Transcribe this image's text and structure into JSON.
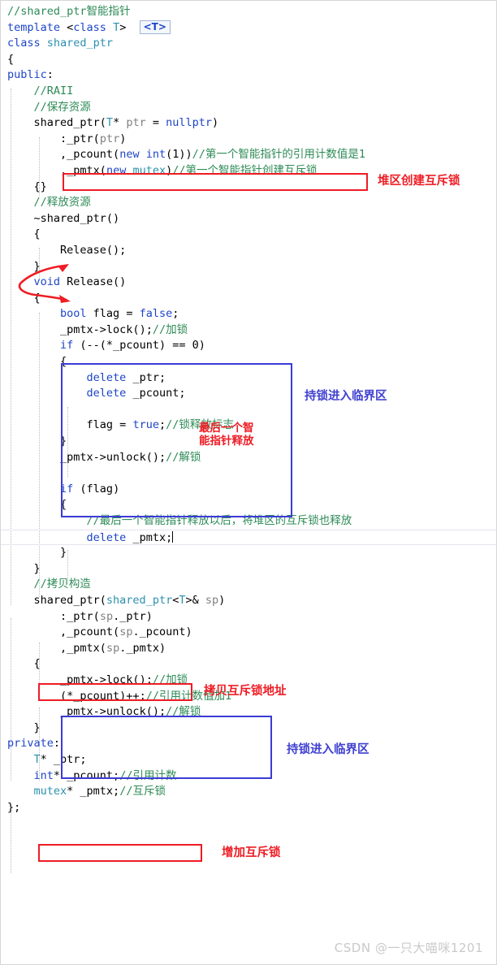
{
  "editor": {
    "language": "C++",
    "tooltip_chip": "<T>",
    "cursor_line_index": 33,
    "colors": {
      "keyword": "#1d45c7",
      "type": "#2b91af",
      "comment": "#2e8b57",
      "plain": "#000000",
      "parameter": "#808080",
      "annotation_red": "#ee1c24",
      "annotation_blue": "#4040d0",
      "background": "#ffffff"
    },
    "lines": [
      {
        "indent": 0,
        "tokens": [
          {
            "t": "cmt",
            "v": "//shared_ptr智能指针"
          }
        ]
      },
      {
        "indent": 0,
        "tokens": [
          {
            "t": "kw",
            "v": "template"
          },
          {
            "t": "pl",
            "v": " <"
          },
          {
            "t": "kw",
            "v": "class"
          },
          {
            "t": "pl",
            "v": " "
          },
          {
            "t": "typ",
            "v": "T"
          },
          {
            "t": "pl",
            "v": ">  "
          }
        ],
        "chip": true
      },
      {
        "indent": 0,
        "tokens": [
          {
            "t": "kw",
            "v": "class"
          },
          {
            "t": "pl",
            "v": " "
          },
          {
            "t": "typ",
            "v": "shared_ptr"
          }
        ]
      },
      {
        "indent": 0,
        "tokens": [
          {
            "t": "pl",
            "v": "{"
          }
        ]
      },
      {
        "indent": 0,
        "tokens": [
          {
            "t": "kw",
            "v": "public"
          },
          {
            "t": "pl",
            "v": ":"
          }
        ]
      },
      {
        "indent": 1,
        "tokens": [
          {
            "t": "cmt",
            "v": "//RAII"
          }
        ]
      },
      {
        "indent": 1,
        "tokens": [
          {
            "t": "cmt",
            "v": "//保存资源"
          }
        ]
      },
      {
        "indent": 1,
        "tokens": [
          {
            "t": "pl",
            "v": "shared_ptr("
          },
          {
            "t": "typ",
            "v": "T"
          },
          {
            "t": "pl",
            "v": "* "
          },
          {
            "t": "par",
            "v": "ptr"
          },
          {
            "t": "pl",
            "v": " = "
          },
          {
            "t": "kw",
            "v": "nullptr"
          },
          {
            "t": "pl",
            "v": ")"
          }
        ]
      },
      {
        "indent": 2,
        "tokens": [
          {
            "t": "pl",
            "v": ":_ptr("
          },
          {
            "t": "par",
            "v": "ptr"
          },
          {
            "t": "pl",
            "v": ")"
          }
        ]
      },
      {
        "indent": 2,
        "tokens": [
          {
            "t": "pl",
            "v": ",_pcount("
          },
          {
            "t": "kw",
            "v": "new"
          },
          {
            "t": "pl",
            "v": " "
          },
          {
            "t": "kw",
            "v": "int"
          },
          {
            "t": "pl",
            "v": "(1))"
          },
          {
            "t": "cmt",
            "v": "//第一个智能指针的引用计数值是1"
          }
        ]
      },
      {
        "indent": 2,
        "tokens": [
          {
            "t": "pl",
            "v": ",_pmtx("
          },
          {
            "t": "kw",
            "v": "new"
          },
          {
            "t": "pl",
            "v": " "
          },
          {
            "t": "typ",
            "v": "mutex"
          },
          {
            "t": "pl",
            "v": ")"
          },
          {
            "t": "cmt",
            "v": "//第一个智能指针创建互斥锁"
          }
        ]
      },
      {
        "indent": 1,
        "tokens": [
          {
            "t": "pl",
            "v": "{}"
          }
        ]
      },
      {
        "indent": 1,
        "tokens": [
          {
            "t": "cmt",
            "v": "//释放资源"
          }
        ]
      },
      {
        "indent": 1,
        "tokens": [
          {
            "t": "pl",
            "v": "~shared_ptr()"
          }
        ]
      },
      {
        "indent": 1,
        "tokens": [
          {
            "t": "pl",
            "v": "{"
          }
        ]
      },
      {
        "indent": 2,
        "tokens": [
          {
            "t": "pl",
            "v": "Release();"
          }
        ]
      },
      {
        "indent": 1,
        "tokens": [
          {
            "t": "pl",
            "v": "}"
          }
        ]
      },
      {
        "indent": 1,
        "tokens": [
          {
            "t": "kw",
            "v": "void"
          },
          {
            "t": "pl",
            "v": " Release()"
          }
        ]
      },
      {
        "indent": 1,
        "tokens": [
          {
            "t": "pl",
            "v": "{"
          }
        ]
      },
      {
        "indent": 2,
        "tokens": [
          {
            "t": "kw",
            "v": "bool"
          },
          {
            "t": "pl",
            "v": " flag = "
          },
          {
            "t": "kw",
            "v": "false"
          },
          {
            "t": "pl",
            "v": ";"
          }
        ]
      },
      {
        "indent": 2,
        "tokens": [
          {
            "t": "pl",
            "v": "_pmtx->lock();"
          },
          {
            "t": "cmt",
            "v": "//加锁"
          }
        ]
      },
      {
        "indent": 2,
        "tokens": [
          {
            "t": "kw",
            "v": "if"
          },
          {
            "t": "pl",
            "v": " (--(*_pcount) == 0)"
          }
        ]
      },
      {
        "indent": 2,
        "tokens": [
          {
            "t": "pl",
            "v": "{"
          }
        ]
      },
      {
        "indent": 3,
        "tokens": [
          {
            "t": "kw",
            "v": "delete"
          },
          {
            "t": "pl",
            "v": " _ptr;"
          }
        ]
      },
      {
        "indent": 3,
        "tokens": [
          {
            "t": "kw",
            "v": "delete"
          },
          {
            "t": "pl",
            "v": " _pcount;"
          }
        ]
      },
      {
        "indent": 3,
        "tokens": [
          {
            "t": "pl",
            "v": ""
          }
        ]
      },
      {
        "indent": 3,
        "tokens": [
          {
            "t": "pl",
            "v": "flag = "
          },
          {
            "t": "kw",
            "v": "true"
          },
          {
            "t": "pl",
            "v": ";"
          },
          {
            "t": "cmt",
            "v": "//锁释放标志"
          }
        ]
      },
      {
        "indent": 2,
        "tokens": [
          {
            "t": "pl",
            "v": "}"
          }
        ]
      },
      {
        "indent": 2,
        "tokens": [
          {
            "t": "pl",
            "v": "_pmtx->unlock();"
          },
          {
            "t": "cmt",
            "v": "//解锁"
          }
        ]
      },
      {
        "indent": 2,
        "tokens": [
          {
            "t": "pl",
            "v": ""
          }
        ]
      },
      {
        "indent": 2,
        "tokens": [
          {
            "t": "kw",
            "v": "if"
          },
          {
            "t": "pl",
            "v": " (flag)"
          }
        ]
      },
      {
        "indent": 2,
        "tokens": [
          {
            "t": "pl",
            "v": "{"
          }
        ]
      },
      {
        "indent": 3,
        "tokens": [
          {
            "t": "cmt",
            "v": "//最后一个智能指针释放以后，将堆区的互斥锁也释放"
          }
        ]
      },
      {
        "indent": 3,
        "tokens": [
          {
            "t": "kw",
            "v": "delete"
          },
          {
            "t": "pl",
            "v": " _pmtx;"
          }
        ]
      },
      {
        "indent": 2,
        "tokens": [
          {
            "t": "pl",
            "v": "}"
          }
        ]
      },
      {
        "indent": 1,
        "tokens": [
          {
            "t": "pl",
            "v": "}"
          }
        ]
      },
      {
        "indent": 1,
        "tokens": [
          {
            "t": "cmt",
            "v": "//拷贝构造"
          }
        ]
      },
      {
        "indent": 1,
        "tokens": [
          {
            "t": "pl",
            "v": "shared_ptr("
          },
          {
            "t": "typ",
            "v": "shared_ptr"
          },
          {
            "t": "pl",
            "v": "<"
          },
          {
            "t": "typ",
            "v": "T"
          },
          {
            "t": "pl",
            "v": ">& "
          },
          {
            "t": "par",
            "v": "sp"
          },
          {
            "t": "pl",
            "v": ")"
          }
        ]
      },
      {
        "indent": 2,
        "tokens": [
          {
            "t": "pl",
            "v": ":_ptr("
          },
          {
            "t": "par",
            "v": "sp"
          },
          {
            "t": "pl",
            "v": "._ptr)"
          }
        ]
      },
      {
        "indent": 2,
        "tokens": [
          {
            "t": "pl",
            "v": ",_pcount("
          },
          {
            "t": "par",
            "v": "sp"
          },
          {
            "t": "pl",
            "v": "._pcount)"
          }
        ]
      },
      {
        "indent": 2,
        "tokens": [
          {
            "t": "pl",
            "v": ",_pmtx("
          },
          {
            "t": "par",
            "v": "sp"
          },
          {
            "t": "pl",
            "v": "._pmtx)"
          }
        ]
      },
      {
        "indent": 1,
        "tokens": [
          {
            "t": "pl",
            "v": "{"
          }
        ]
      },
      {
        "indent": 2,
        "tokens": [
          {
            "t": "pl",
            "v": "_pmtx->lock();"
          },
          {
            "t": "cmt",
            "v": "//加锁"
          }
        ]
      },
      {
        "indent": 2,
        "tokens": [
          {
            "t": "pl",
            "v": "(*_pcount)++;"
          },
          {
            "t": "cmt",
            "v": "//引用计数值加1"
          }
        ]
      },
      {
        "indent": 2,
        "tokens": [
          {
            "t": "pl",
            "v": "_pmtx->unlock();"
          },
          {
            "t": "cmt",
            "v": "//解锁"
          }
        ]
      },
      {
        "indent": 1,
        "tokens": [
          {
            "t": "pl",
            "v": "}"
          }
        ]
      },
      {
        "indent": 0,
        "tokens": [
          {
            "t": "kw",
            "v": "private"
          },
          {
            "t": "pl",
            "v": ":"
          }
        ]
      },
      {
        "indent": 1,
        "tokens": [
          {
            "t": "typ",
            "v": "T"
          },
          {
            "t": "pl",
            "v": "* _ptr;"
          }
        ]
      },
      {
        "indent": 1,
        "tokens": [
          {
            "t": "kw",
            "v": "int"
          },
          {
            "t": "pl",
            "v": "* _pcount;"
          },
          {
            "t": "cmt",
            "v": "//引用计数"
          }
        ]
      },
      {
        "indent": 1,
        "tokens": [
          {
            "t": "typ",
            "v": "mutex"
          },
          {
            "t": "pl",
            "v": "* _pmtx;"
          },
          {
            "t": "cmt",
            "v": "//互斥锁"
          }
        ]
      },
      {
        "indent": 0,
        "tokens": [
          {
            "t": "pl",
            "v": "};"
          }
        ]
      }
    ]
  },
  "annotations": {
    "heap_create_mutex": "堆区创建互斥锁",
    "last_ptr_release": "最后一个智\n能指针释放",
    "hold_lock_critical_1": "持锁进入临界区",
    "copy_mutex_address": "拷贝互斥锁地址",
    "hold_lock_critical_2": "持锁进入临界区",
    "add_mutex": "增加互斥锁"
  },
  "watermark": {
    "text": "CSDN @一只大喵咪1201"
  }
}
